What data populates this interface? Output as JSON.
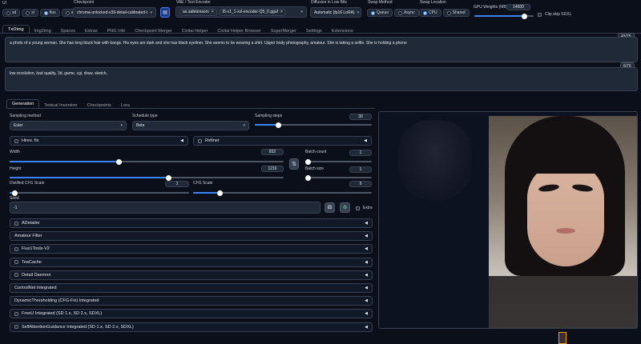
{
  "ui_label": "UI",
  "ui_options": [
    "sd",
    "xl",
    "flux",
    "all"
  ],
  "ui_selected": "flux",
  "checkpoint": {
    "label": "Checkpoint",
    "value": "chroma-unlocked-v39-detail-calibrated-t"
  },
  "vae": {
    "label": "VAE / Text Encoder",
    "value1": "ae.safetensors",
    "value2": "t5-v1_1-xxl-encoder-Q5_0.gguf"
  },
  "diffusion": {
    "label": "Diffusion in Low Bits",
    "value": "Automatic (fp16 LoRA)"
  },
  "swap_method": {
    "label": "Swap Method",
    "options": [
      "Queue",
      "Async"
    ],
    "selected": "Queue"
  },
  "swap_location": {
    "label": "Swap Location",
    "options": [
      "CPU",
      "Shared"
    ],
    "selected": "CPU"
  },
  "gpu_weights": {
    "label": "GPU Weights (MB)",
    "value": "14600",
    "level": 0.85
  },
  "clip_skip": {
    "label": "Clip skip SDXL"
  },
  "main_tabs": [
    "Txt2img",
    "Img2img",
    "Spaces",
    "Extras",
    "PNG Info",
    "Checkpoint Merger",
    "Civitai Helper",
    "Civitai Helper Browser",
    "SuperMerger",
    "Settings",
    "Extensions"
  ],
  "prompt": {
    "text": "a photo of a young woman. She has long black hair with bangs. His eyes are dark and she has black eyeliner. She seems to be wearing a shirt. Upper body photography, amateur. She is taking a selfie. She is holding a phone",
    "counter": "43/75"
  },
  "negative": {
    "text": "low resolution, bad quality, 3d, game, cgi, draw, sketch,",
    "counter": "6/75"
  },
  "sub_tabs": [
    "Generation",
    "Textual Inversion",
    "Checkpoints",
    "Lora"
  ],
  "sampling_method": {
    "label": "Sampling method",
    "value": "Euler"
  },
  "schedule_type": {
    "label": "Schedule type",
    "value": "Beta"
  },
  "sampling_steps": {
    "label": "Sampling steps",
    "value": "30",
    "level": 0.2
  },
  "hires_fix": "Hires. fix",
  "refiner": "Refiner",
  "width": {
    "label": "Width",
    "value": "832",
    "level": 0.4
  },
  "height": {
    "label": "Height",
    "value": "1216",
    "level": 0.58
  },
  "batch_count": {
    "label": "Batch count",
    "value": "1",
    "level": 0.0
  },
  "batch_size": {
    "label": "Batch size",
    "value": "1",
    "level": 0.0
  },
  "swap_icon": "⇅",
  "distilled_cfg": {
    "label": "Distilled CFG Scale",
    "value": "1",
    "level": 0.03
  },
  "cfg_scale": {
    "label": "CFG Scale",
    "value": "5",
    "level": 0.15
  },
  "seed": {
    "label": "Seed",
    "value": "-1",
    "extra": "Extra"
  },
  "accordions": [
    {
      "label": "ADetailer",
      "checkbox": true
    },
    {
      "label": "Amateur Filter",
      "checkbox": false
    },
    {
      "label": "Flux1Tools-V2",
      "checkbox": true
    },
    {
      "label": "TeaCache",
      "checkbox": true
    },
    {
      "label": "Detail Daemon",
      "checkbox": true
    },
    {
      "label": "ControlNet Integrated",
      "checkbox": false
    },
    {
      "label": "DynamicThresholding (CFG-Fix) Integrated",
      "checkbox": false
    },
    {
      "label": "FreeU Integrated (SD 1.x, SD 2.x, SDXL)",
      "checkbox": true
    },
    {
      "label": "SelfAttentionGuidance Integrated (SD 1.x, SD 2.x, SDXL)",
      "checkbox": true
    }
  ]
}
